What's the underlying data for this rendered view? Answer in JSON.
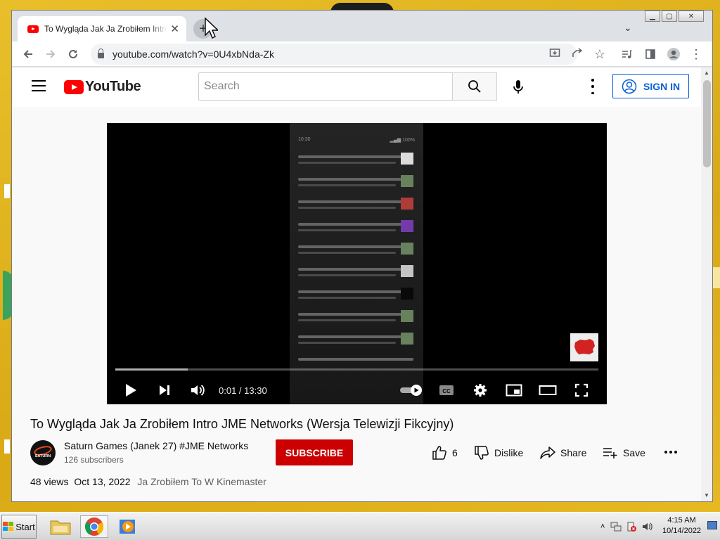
{
  "browser": {
    "tab_title": "To Wygląda Jak Ja Zrobiłem Intro JME",
    "url": "youtube.com/watch?v=0U4xbNda-Zk"
  },
  "youtube": {
    "logo_text": "YouTube",
    "search_placeholder": "Search",
    "sign_in": "SIGN IN"
  },
  "player": {
    "time": "0:01 / 13:30",
    "progress": 0.0013,
    "buffered_fraction": 0.15
  },
  "video": {
    "title": "To Wygląda Jak Ja Zrobiłem Intro JME Networks (Wersja Telewizji Fikcyjny)",
    "channel_name": "Saturn Games (Janek 27) #JME Networks",
    "subscribers": "126 subscribers",
    "avatar_text": "SATURN",
    "subscribe_label": "SUBSCRIBE",
    "like_count": "6",
    "dislike_label": "Dislike",
    "share_label": "Share",
    "save_label": "Save",
    "views": "48 views",
    "date": "Oct 13, 2022",
    "description": "Ja Zrobiłem To W Kinemaster"
  },
  "taskbar": {
    "start_label": "Start",
    "time": "4:15 AM",
    "date": "10/14/2022"
  },
  "colors": {
    "yt_red": "#ff0000",
    "subscribe_red": "#cc0000",
    "link_blue": "#065fd4",
    "desktop_yellow": "#e4b51c"
  }
}
